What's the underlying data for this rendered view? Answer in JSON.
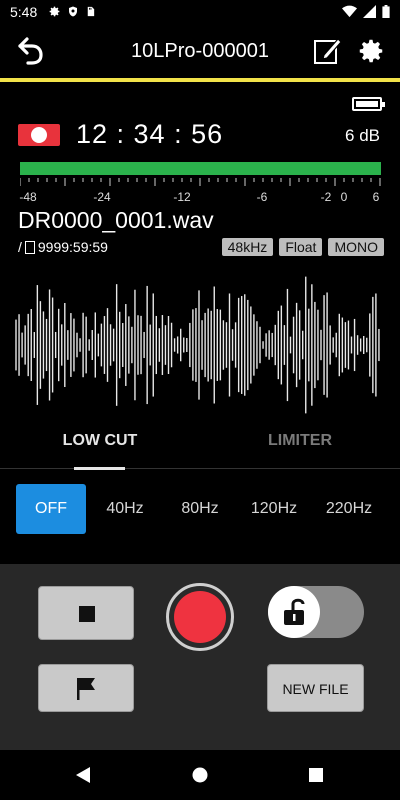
{
  "status_bar": {
    "time": "5:48",
    "left_icons": [
      "gear-icon",
      "shield-icon",
      "sd-card-icon"
    ],
    "right_icons": [
      "wifi-icon",
      "signal-icon",
      "battery-icon"
    ]
  },
  "app_bar": {
    "title": "10LPro-000001",
    "back_icon": "back-arrow-icon",
    "edit_icon": "edit-icon",
    "settings_icon": "gear-icon",
    "accent_color": "#f2e34a"
  },
  "recorder": {
    "battery_level": 1.0,
    "rec_time": "12 : 34 : 56",
    "level": "6 dB",
    "meter_fill": 1.0,
    "meter_color": "#2bb24c",
    "scale_labels": [
      "-48",
      "-24",
      "-12",
      "-6",
      "-2",
      "0",
      "6"
    ],
    "filename": "DR0000_0001.wav",
    "remaining_prefix": "/",
    "remaining_time": "9999:59:59",
    "badges": [
      "48kHz",
      "Float",
      "MONO"
    ]
  },
  "tabs": [
    {
      "label": "LOW CUT",
      "active": true
    },
    {
      "label": "LIMITER",
      "active": false
    }
  ],
  "low_cut_options": [
    {
      "label": "OFF",
      "active": true
    },
    {
      "label": "40Hz",
      "active": false
    },
    {
      "label": "80Hz",
      "active": false
    },
    {
      "label": "120Hz",
      "active": false
    },
    {
      "label": "220Hz",
      "active": false
    }
  ],
  "controls": {
    "stop_icon": "stop-icon",
    "record_icon": "record-icon",
    "mark_icon": "flag-icon",
    "lock_icon": "unlock-icon",
    "new_file_label": "NEW FILE",
    "record_color": "#ef3340",
    "active_color": "#1c8de0"
  },
  "nav_bar": {
    "icons": [
      "back-triangle-icon",
      "home-circle-icon",
      "recents-square-icon"
    ]
  }
}
